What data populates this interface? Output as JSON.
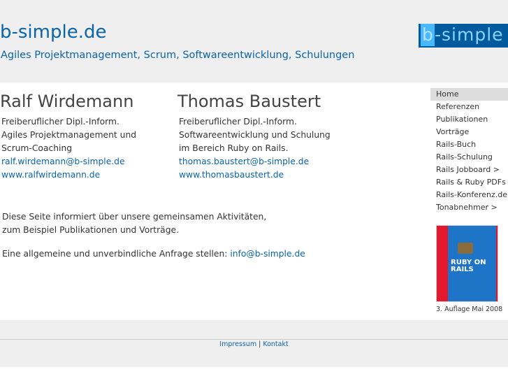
{
  "header": {
    "title": "b-simple.de",
    "tagline": "Agiles Projektmanagement, Scrum, Softwareentwicklung, Schulungen",
    "logo_b": "b",
    "logo_rest": "-simple"
  },
  "people": [
    {
      "name": "Ralf Wirdemann",
      "lines": [
        "Freiberuflicher Dipl.-Inform.",
        "Agiles Projektmanagement und",
        "Scrum-Coaching"
      ],
      "email": "ralf.wirdemann@b-simple.de",
      "web": "www.ralfwirdemann.de"
    },
    {
      "name": "Thomas Baustert",
      "lines": [
        "Freiberuflicher Dipl.-Inform.",
        "Softwareentwicklung und Schulung",
        "im Bereich Ruby on Rails."
      ],
      "email": "thomas.baustert@b-simple.de",
      "web": "www.thomasbaustert.de"
    }
  ],
  "intro": [
    "Diese Seite informiert über unsere gemeinsamen Aktivitäten,",
    "zum Beispiel Publikationen und Vorträge."
  ],
  "inquiry": {
    "text": "Eine allgemeine und unverbindliche Anfrage stellen: ",
    "email": "info@b-simple.de"
  },
  "nav": [
    "Home",
    "Referenzen",
    "Publikationen",
    "Vorträge",
    "Rails-Buch",
    "Rails-Schulung",
    "Rails Jobboard >",
    "Rails & Ruby PDFs",
    "Rails-Konferenz.de",
    "Tonabnehmer >"
  ],
  "book": {
    "cover_title": "RUBY ON RAILS",
    "caption": "3. Auflage Mai 2008"
  },
  "footer": {
    "impressum": "Impressum",
    "separator": " | ",
    "kontakt": "Kontakt"
  }
}
